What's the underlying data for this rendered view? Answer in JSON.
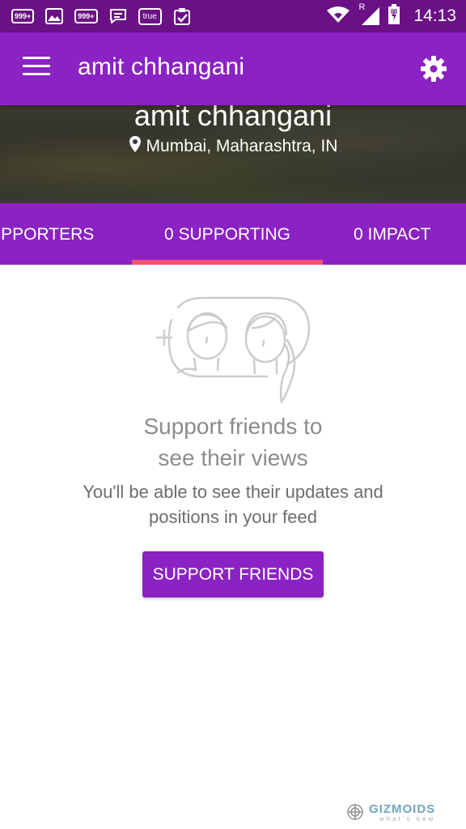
{
  "status_bar": {
    "time": "14:13",
    "badge1": "999+",
    "badge2": "999+",
    "true_app": "true",
    "roaming": "R",
    "icons": [
      "messenger-999-icon",
      "gallery-icon",
      "messenger-999-icon",
      "message-icon",
      "true-app-icon",
      "clipboard-check-icon",
      "wifi-icon",
      "signal-icon",
      "battery-icon"
    ]
  },
  "app_bar": {
    "title": "amit chhangani",
    "menu_icon": "hamburger-menu-icon",
    "settings_icon": "gear-icon"
  },
  "profile": {
    "name": "amit chhangani",
    "location": "Mumbai, Maharashtra, IN",
    "location_icon": "map-pin-icon"
  },
  "tabs": [
    {
      "label": "UPPORTERS"
    },
    {
      "label": "0 SUPPORTING",
      "selected": true
    },
    {
      "label": "0 IMPACT"
    }
  ],
  "empty_state": {
    "illustration": "add-friends-illustration",
    "title_line1": "Support friends to",
    "title_line2": "see their views",
    "desc_line1": "You'll be able to see their updates and",
    "desc_line2": "positions in your feed",
    "button_label": "SUPPORT FRIENDS"
  },
  "watermark": {
    "brand": "GIZMOIDS",
    "tagline": "what's new"
  },
  "colors": {
    "status_bar": "#6b1185",
    "primary": "#8b22c3",
    "tab_indicator": "#f35473",
    "illustration_line": "#cccccc"
  }
}
